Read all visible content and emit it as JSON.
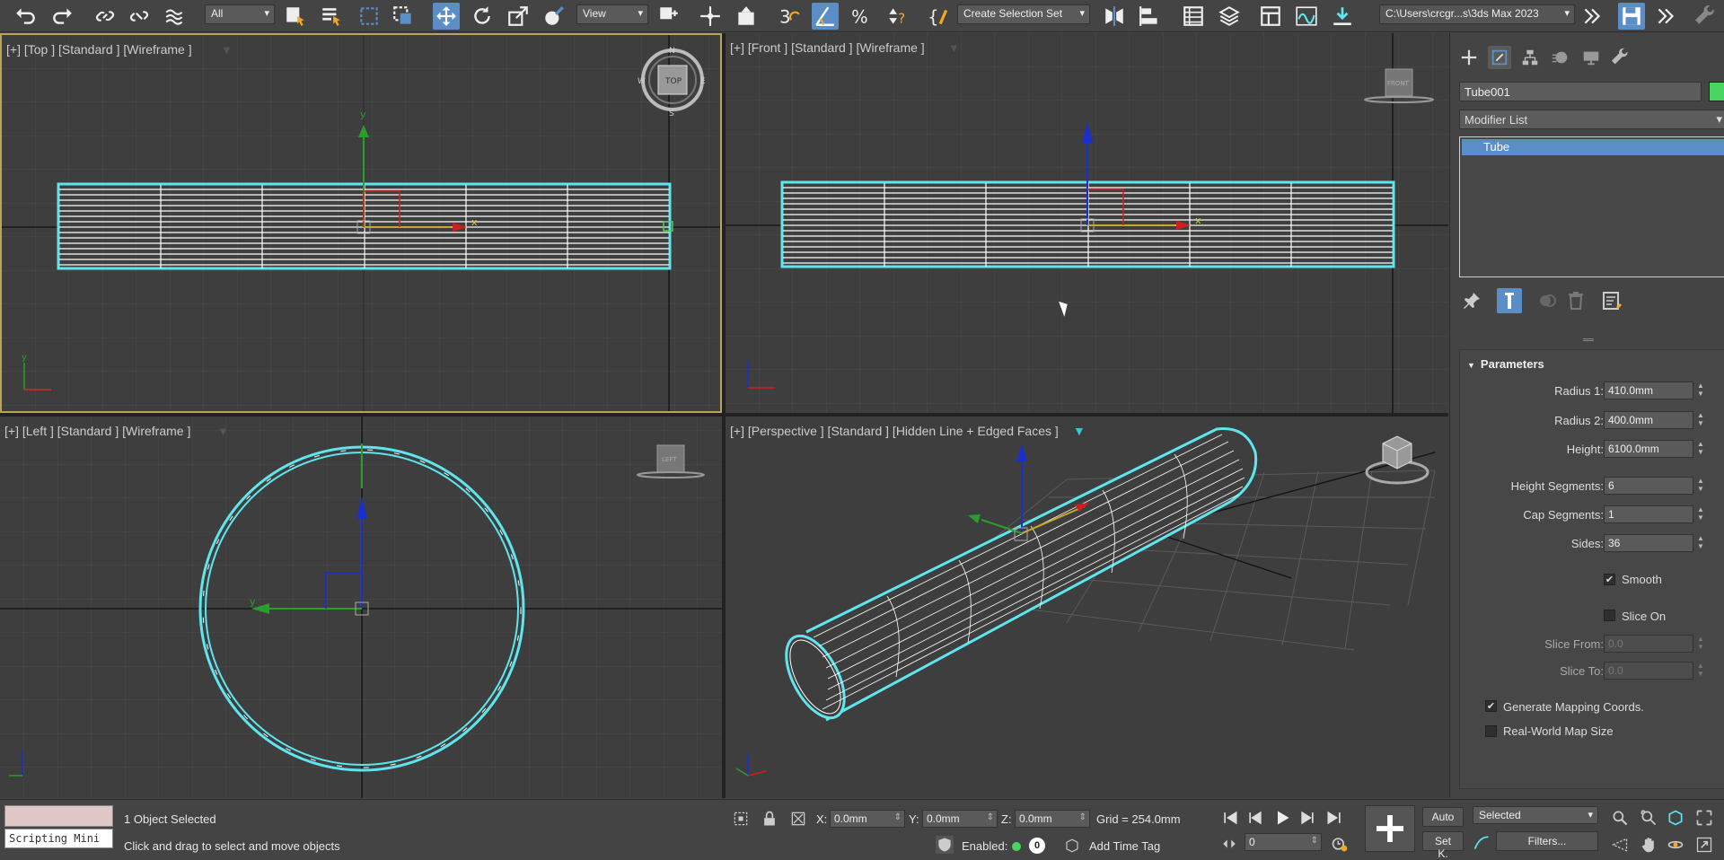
{
  "toolbar": {
    "selection_filter": "All",
    "ref_coord": "View",
    "named_selection": "Create Selection Set",
    "project_path": "C:\\Users\\crcgr...s\\3ds Max 2023"
  },
  "viewports": {
    "top": {
      "label": "[+] [Top ] [Standard ] [Wireframe ]",
      "gizmo_text": "TOP",
      "compass": [
        "N",
        "E",
        "S",
        "W"
      ]
    },
    "front": {
      "label": "[+] [Front ] [Standard ] [Wireframe ]",
      "gizmo_text": "FRONT"
    },
    "left": {
      "label": "[+] [Left ] [Standard ] [Wireframe ]",
      "gizmo_text": "LEFT"
    },
    "perspective": {
      "label": "[+] [Perspective ] [Standard ] [Hidden Line + Edged Faces ]"
    }
  },
  "command_panel": {
    "object_name": "Tube001",
    "object_color": "#4ad461",
    "modifier_list": "Modifier List",
    "stack_items": [
      "Tube"
    ],
    "rollout_title": "Parameters",
    "params": [
      {
        "label": "Radius 1:",
        "value": "410.0mm"
      },
      {
        "label": "Radius 2:",
        "value": "400.0mm"
      },
      {
        "label": "Height:",
        "value": "6100.0mm"
      },
      {
        "label": "Height Segments:",
        "value": "6"
      },
      {
        "label": "Cap Segments:",
        "value": "1"
      },
      {
        "label": "Sides:",
        "value": "36"
      }
    ],
    "smooth_label": "Smooth",
    "smooth_checked": true,
    "slice_on_label": "Slice On",
    "slice_on_checked": false,
    "slice_from_label": "Slice From:",
    "slice_from_value": "0.0",
    "slice_to_label": "Slice To:",
    "slice_to_value": "0.0",
    "gen_mapping_label": "Generate Mapping Coords.",
    "gen_mapping_checked": true,
    "real_world_label": "Real-World Map Size",
    "real_world_checked": false
  },
  "status": {
    "scripting": "Scripting Mini",
    "selection": "1 Object Selected",
    "prompt": "Click and drag to select and move objects",
    "x_label": "X:",
    "x_value": "0.0mm",
    "y_label": "Y:",
    "y_value": "0.0mm",
    "z_label": "Z:",
    "z_value": "0.0mm",
    "grid": "Grid = 254.0mm",
    "enabled_label": "Enabled:",
    "enabled_badge": "0",
    "add_time_tag": "Add Time Tag",
    "frame": "0",
    "auto": "Auto",
    "setk": "Set K.",
    "key_filter": "Selected",
    "filters": "Filters..."
  },
  "colors": {
    "accent": "#5b8ec7",
    "selection": "#5ee6ee",
    "viewport_bg": "#3e3e3e"
  }
}
